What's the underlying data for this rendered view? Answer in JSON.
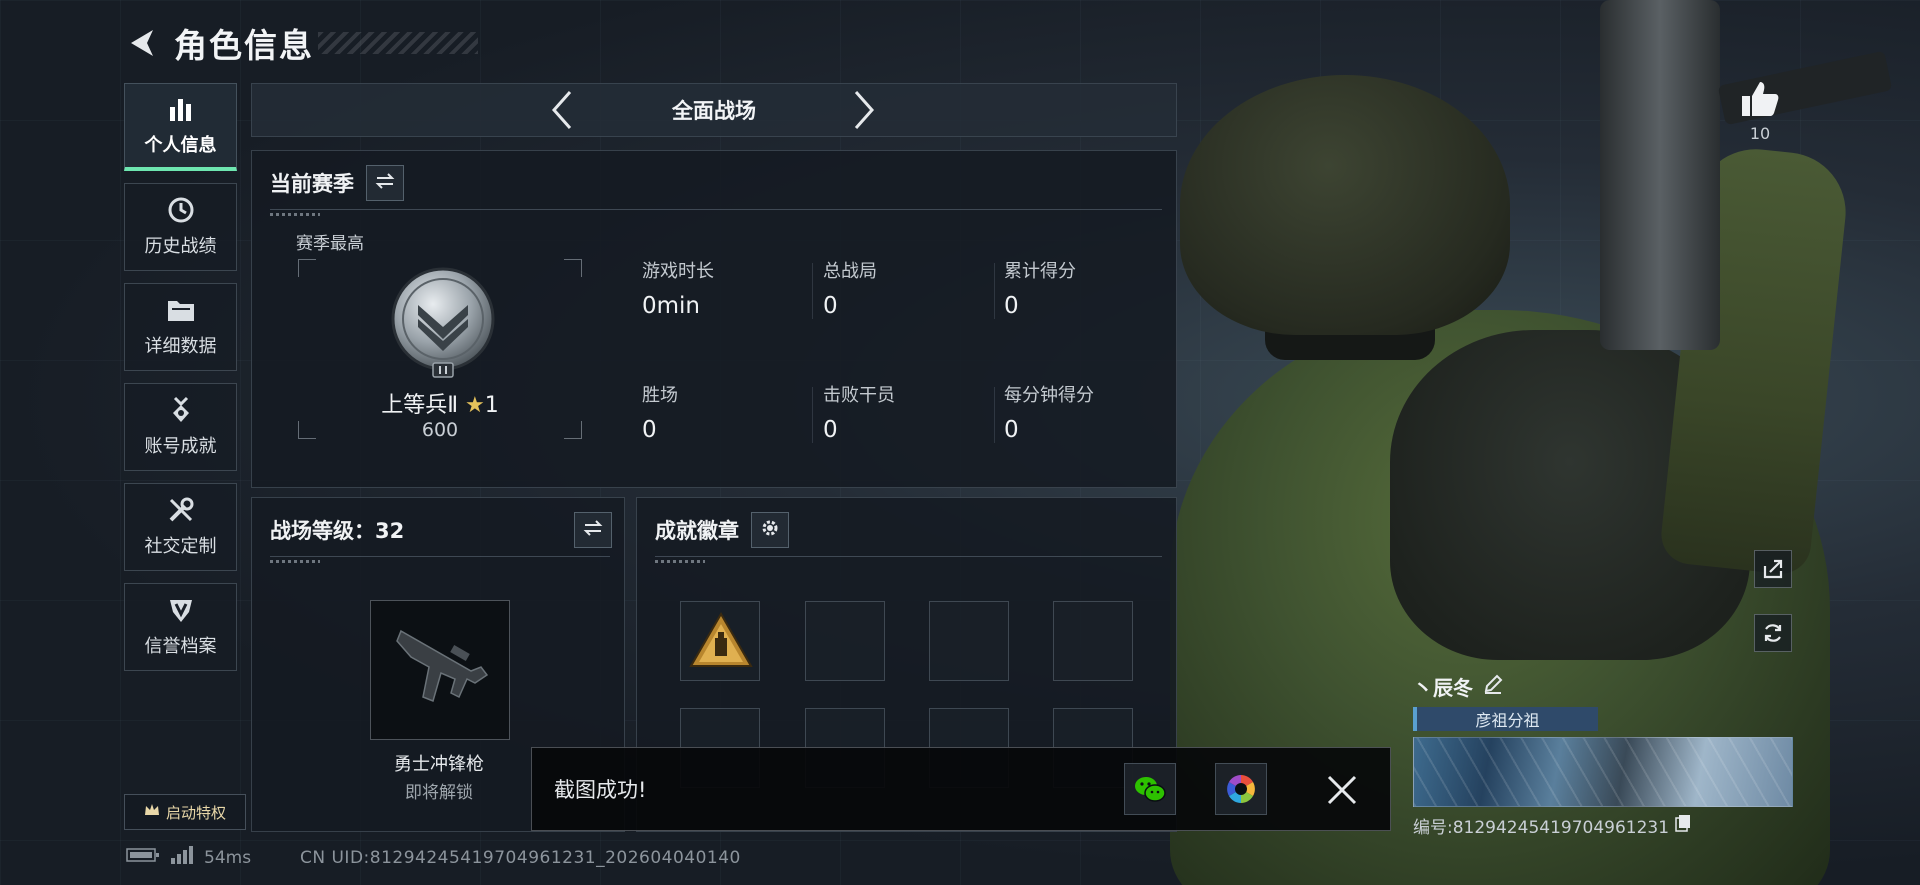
{
  "header": {
    "title": "角色信息"
  },
  "sidebar": {
    "items": [
      {
        "label": "个人信息",
        "icon": "bar-chart-icon",
        "active": true
      },
      {
        "label": "历史战绩",
        "icon": "clock-icon"
      },
      {
        "label": "详细数据",
        "icon": "folder-icon"
      },
      {
        "label": "账号成就",
        "icon": "medal-icon"
      },
      {
        "label": "社交定制",
        "icon": "tools-icon"
      },
      {
        "label": "信誉档案",
        "icon": "shield-badge-icon"
      }
    ],
    "perk_label": "启动特权"
  },
  "mode": {
    "title": "全面战场"
  },
  "season": {
    "title": "当前赛季",
    "best_label": "赛季最高",
    "rank_name": "上等兵Ⅱ",
    "rank_stars": "1",
    "rank_score": "600",
    "stats": [
      {
        "label": "游戏时长",
        "value": "0min"
      },
      {
        "label": "总战局",
        "value": "0"
      },
      {
        "label": "累计得分",
        "value": "0"
      },
      {
        "label": "胜场",
        "value": "0"
      },
      {
        "label": "击败干员",
        "value": "0"
      },
      {
        "label": "每分钟得分",
        "value": "0"
      }
    ]
  },
  "level": {
    "title": "战场等级：32",
    "weapon_name": "勇士冲锋枪",
    "weapon_status": "即将解锁"
  },
  "achievements": {
    "title": "成就徽章"
  },
  "toast": {
    "text": "截图成功!"
  },
  "status": {
    "ping": "54ms",
    "uid": "CN UID:81294245419704961231_202604040140"
  },
  "profile": {
    "likes": "10",
    "name": "丶辰冬",
    "guild": "彦祖分祖",
    "id": "编号:81294245419704961231"
  },
  "colors": {
    "accent": "#6ee6b0",
    "star": "#e5c25b",
    "guild": "#2f4a6a"
  }
}
